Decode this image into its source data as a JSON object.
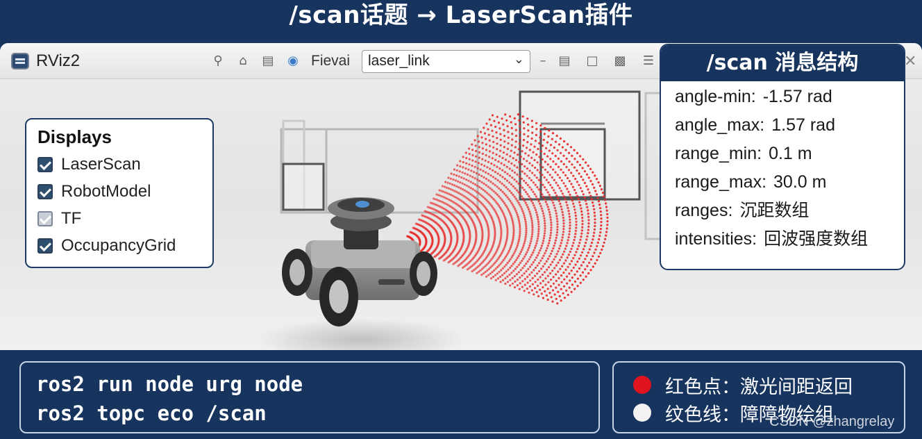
{
  "title": "/scan话题 → LaserScan插件",
  "window": {
    "app_name": "RViz2",
    "fixed_frame_label": "Fievai",
    "fixed_frame_value": "laser_link",
    "toolbar_icons": [
      "search-icon",
      "home-icon",
      "panel-icon",
      "globe-icon",
      "minus-icon",
      "window-icon",
      "square-icon",
      "image-icon",
      "menu-icon"
    ]
  },
  "displays": {
    "title": "Displays",
    "items": [
      {
        "label": "LaserScan",
        "checked": true
      },
      {
        "label": "RobotModel",
        "checked": true
      },
      {
        "label": "TF",
        "checked": true
      },
      {
        "label": "OccupancyGrid",
        "checked": true
      }
    ]
  },
  "scan_message": {
    "title": "/scan 消息结构",
    "fields": [
      {
        "key": "angle-min:",
        "value": "-1.57 rad"
      },
      {
        "key": "angle_max:",
        "value": "1.57 rad"
      },
      {
        "key": "range_min:",
        "value": "0.1 m"
      },
      {
        "key": "range_max:",
        "value": "30.0 m"
      },
      {
        "key": "ranges:",
        "value": "沉距数组"
      },
      {
        "key": "intensities:",
        "value": "回波强度数组"
      }
    ]
  },
  "commands": [
    "ros2 run node urg node",
    "ros2 topc eco /scan"
  ],
  "legend": [
    {
      "label": "红色点：激光间距返回",
      "color": "#e0141e"
    },
    {
      "label": "纹色线：障障物绘组",
      "color": "#f2f2f2"
    }
  ],
  "watermark": "CSDN @zhangrelay",
  "colors": {
    "accent": "#17345e",
    "scan_point": "#e82a2a"
  }
}
